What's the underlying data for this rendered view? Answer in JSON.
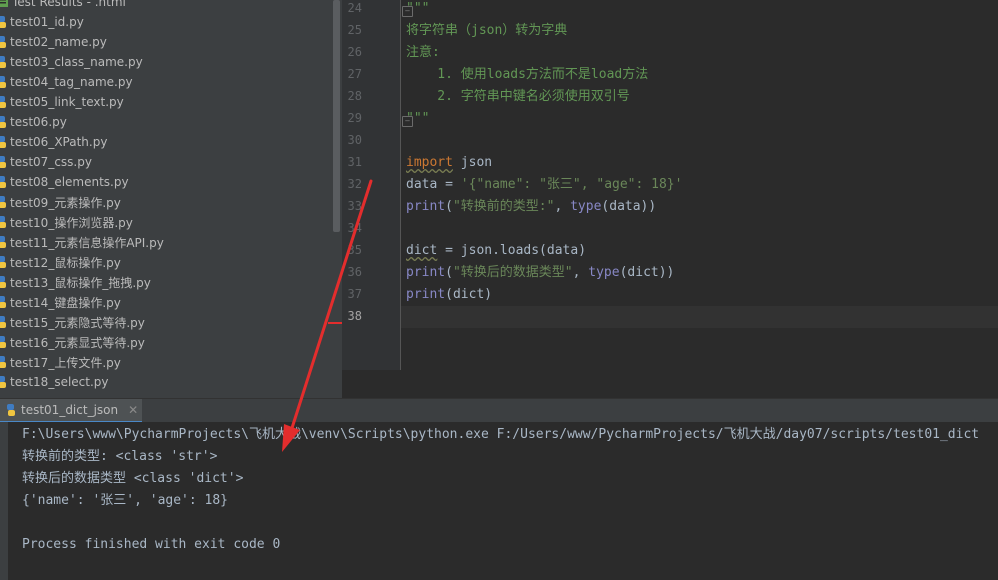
{
  "project_tree": {
    "items": [
      {
        "label": "Test Results - .html",
        "icon": "test-results-icon"
      },
      {
        "label": "test01_id.py",
        "icon": "python-file-icon"
      },
      {
        "label": "test02_name.py",
        "icon": "python-file-icon"
      },
      {
        "label": "test03_class_name.py",
        "icon": "python-file-icon"
      },
      {
        "label": "test04_tag_name.py",
        "icon": "python-file-icon"
      },
      {
        "label": "test05_link_text.py",
        "icon": "python-file-icon"
      },
      {
        "label": "test06.py",
        "icon": "python-file-icon"
      },
      {
        "label": "test06_XPath.py",
        "icon": "python-file-icon"
      },
      {
        "label": "test07_css.py",
        "icon": "python-file-icon"
      },
      {
        "label": "test08_elements.py",
        "icon": "python-file-icon"
      },
      {
        "label": "test09_元素操作.py",
        "icon": "python-file-icon"
      },
      {
        "label": "test10_操作浏览器.py",
        "icon": "python-file-icon"
      },
      {
        "label": "test11_元素信息操作API.py",
        "icon": "python-file-icon"
      },
      {
        "label": "test12_鼠标操作.py",
        "icon": "python-file-icon"
      },
      {
        "label": "test13_鼠标操作_拖拽.py",
        "icon": "python-file-icon"
      },
      {
        "label": "test14_键盘操作.py",
        "icon": "python-file-icon"
      },
      {
        "label": "test15_元素隐式等待.py",
        "icon": "python-file-icon"
      },
      {
        "label": "test16_元素显式等待.py",
        "icon": "python-file-icon"
      },
      {
        "label": "test17_上传文件.py",
        "icon": "python-file-icon"
      },
      {
        "label": "test18_select.py",
        "icon": "python-file-icon"
      }
    ]
  },
  "editor": {
    "current_line": "38",
    "lines": [
      {
        "num": "24",
        "parts": [
          {
            "text": "\"\"\"",
            "cls": "cmt"
          }
        ]
      },
      {
        "num": "25",
        "parts": [
          {
            "text": "将字符串（json）转为字典",
            "cls": "cmt"
          }
        ]
      },
      {
        "num": "26",
        "parts": [
          {
            "text": "注意:",
            "cls": "cmt"
          }
        ]
      },
      {
        "num": "27",
        "parts": [
          {
            "text": "    1. 使用loads方法而不是load方法",
            "cls": "cmt"
          }
        ]
      },
      {
        "num": "28",
        "parts": [
          {
            "text": "    2. 字符串中键名必须使用双引号",
            "cls": "cmt"
          }
        ]
      },
      {
        "num": "29",
        "parts": [
          {
            "text": "\"\"\"",
            "cls": "cmt"
          }
        ]
      },
      {
        "num": "30",
        "parts": []
      },
      {
        "num": "31",
        "parts": [
          {
            "text": "import",
            "cls": "kw wavy"
          },
          {
            "text": " json",
            "cls": ""
          }
        ]
      },
      {
        "num": "32",
        "parts": [
          {
            "text": "data = ",
            "cls": ""
          },
          {
            "text": "'{\"name\": \"张三\", \"age\": 18}'",
            "cls": "str"
          }
        ]
      },
      {
        "num": "33",
        "parts": [
          {
            "text": "print",
            "cls": "fn"
          },
          {
            "text": "(",
            "cls": ""
          },
          {
            "text": "\"转换前的类型:\"",
            "cls": "str"
          },
          {
            "text": ", ",
            "cls": ""
          },
          {
            "text": "type",
            "cls": "fn"
          },
          {
            "text": "(data))",
            "cls": ""
          }
        ]
      },
      {
        "num": "34",
        "parts": []
      },
      {
        "num": "35",
        "parts": [
          {
            "text": "dict",
            "cls": "wavy"
          },
          {
            "text": " = json.loads(data)",
            "cls": ""
          }
        ]
      },
      {
        "num": "36",
        "parts": [
          {
            "text": "print",
            "cls": "fn"
          },
          {
            "text": "(",
            "cls": ""
          },
          {
            "text": "\"转换后的数据类型\"",
            "cls": "str"
          },
          {
            "text": ", ",
            "cls": ""
          },
          {
            "text": "type",
            "cls": "fn"
          },
          {
            "text": "(dict))",
            "cls": ""
          }
        ]
      },
      {
        "num": "37",
        "parts": [
          {
            "text": "print",
            "cls": "fn"
          },
          {
            "text": "(dict)",
            "cls": ""
          }
        ]
      },
      {
        "num": "38",
        "parts": []
      }
    ]
  },
  "run_panel": {
    "tab_label": "test01_dict_json",
    "tab_icon": "python-run-icon",
    "close_glyph": "✕",
    "output": [
      "F:\\Users\\www\\PycharmProjects\\飞机大战\\venv\\Scripts\\python.exe F:/Users/www/PycharmProjects/飞机大战/day07/scripts/test01_dict",
      "转换前的类型: <class 'str'>",
      "转换后的数据类型 <class 'dict'>",
      "{'name': '张三', 'age': 18}",
      "",
      "Process finished with exit code 0"
    ]
  },
  "colors": {
    "annotation_red": "#e32d2d",
    "comment": "#629755",
    "keyword": "#cc7832",
    "string": "#6a8759",
    "builtin": "#8888c6"
  }
}
